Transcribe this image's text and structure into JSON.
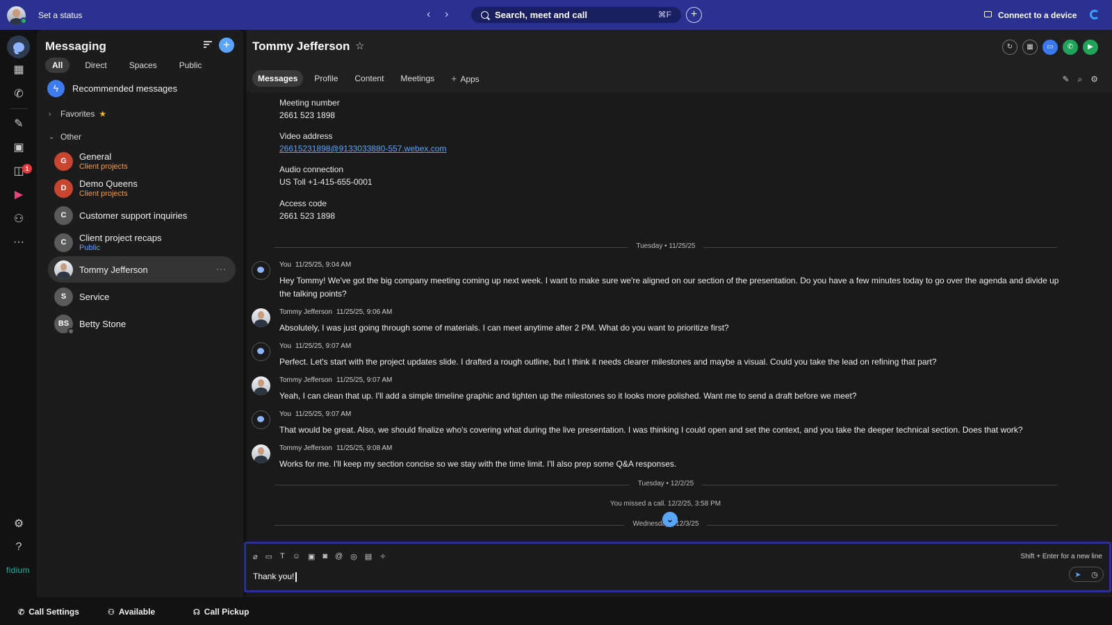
{
  "topbar": {
    "status_text": "Set a status",
    "search_placeholder": "Search, meet and call",
    "search_shortcut": "⌘F",
    "connect_label": "Connect to a device"
  },
  "rail": {
    "badge_count": "1",
    "brand": "fidium"
  },
  "sidebar": {
    "title": "Messaging",
    "tabs": [
      "All",
      "Direct",
      "Spaces",
      "Public"
    ],
    "recommended": "Recommended messages",
    "favorites_label": "Favorites",
    "other_label": "Other",
    "conversations": [
      {
        "initial": "G",
        "name": "General",
        "sub": "Client projects",
        "color": "#c8452f",
        "sub_color": "orange"
      },
      {
        "initial": "D",
        "name": "Demo Queens",
        "sub": "Client projects",
        "color": "#c8452f",
        "sub_color": "orange"
      },
      {
        "initial": "C",
        "name": "Customer support inquiries",
        "sub": "",
        "color": "#5a5a5a"
      },
      {
        "initial": "C",
        "name": "Client project recaps",
        "sub": "Public",
        "color": "#5a5a5a",
        "sub_color": "blue"
      },
      {
        "initial": "",
        "name": "Tommy Jefferson",
        "sub": "",
        "selected": true
      },
      {
        "initial": "S",
        "name": "Service",
        "sub": "",
        "color": "#5a5a5a"
      },
      {
        "initial": "BS",
        "name": "Betty Stone",
        "sub": "",
        "color": "#5a5a5a"
      }
    ]
  },
  "bottombar": {
    "call_settings": "Call Settings",
    "available": "Available",
    "call_pickup": "Call Pickup"
  },
  "main": {
    "contact_name": "Tommy Jefferson",
    "tabs": [
      "Messages",
      "Profile",
      "Content",
      "Meetings",
      "Apps"
    ],
    "meeting_info": {
      "meeting_number_label": "Meeting number",
      "meeting_number": "2661 523 1898",
      "video_address_label": "Video address",
      "video_address": "26615231898@9133033880-557.webex.com",
      "audio_label": "Audio connection",
      "audio_value": "US Toll +1-415-655-0001",
      "access_code_label": "Access code",
      "access_code": "2661 523 1898"
    },
    "dividers": [
      "Tuesday • 11/25/25",
      "Tuesday • 12/2/25",
      "Wednesday • 12/3/25"
    ],
    "missed_call": "You missed a call. 12/2/25, 3:58 PM",
    "messages": [
      {
        "sender": "You",
        "time": "11/25/25, 9:04 AM",
        "text": "Hey Tommy! We've got the big company meeting coming up next week. I want to make sure we're aligned on our section of the presentation. Do you have a few minutes today to go over the agenda and divide up the talking points?"
      },
      {
        "sender": "Tommy Jefferson",
        "time": "11/25/25, 9:06 AM",
        "text": "Absolutely, I was just going through some of materials. I can meet anytime after 2 PM. What do you want to prioritize first?"
      },
      {
        "sender": "You",
        "time": "11/25/25, 9:07 AM",
        "text": "Perfect. Let's start with the project updates slide. I drafted a rough outline, but I think it needs clearer milestones and maybe a visual. Could you take the lead on refining that part?"
      },
      {
        "sender": "Tommy Jefferson",
        "time": "11/25/25, 9:07 AM",
        "text": "Yeah, I can clean that up. I'll add a simple timeline graphic and tighten up the milestones so it looks more polished. Want me to send a draft before we meet?"
      },
      {
        "sender": "You",
        "time": "11/25/25, 9:07 AM",
        "text": "That would be great. Also, we should finalize who's covering what during the live presentation. I was thinking I could open and set the context, and you take the deeper technical section. Does that work?"
      },
      {
        "sender": "Tommy Jefferson",
        "time": "11/25/25, 9:08 AM",
        "text": "Works for me. I'll keep my section concise so we stay with the time limit. I'll also prep some Q&A responses."
      }
    ],
    "composer": {
      "value": "Thank you!",
      "hint": "Shift + Enter for a new line"
    }
  }
}
